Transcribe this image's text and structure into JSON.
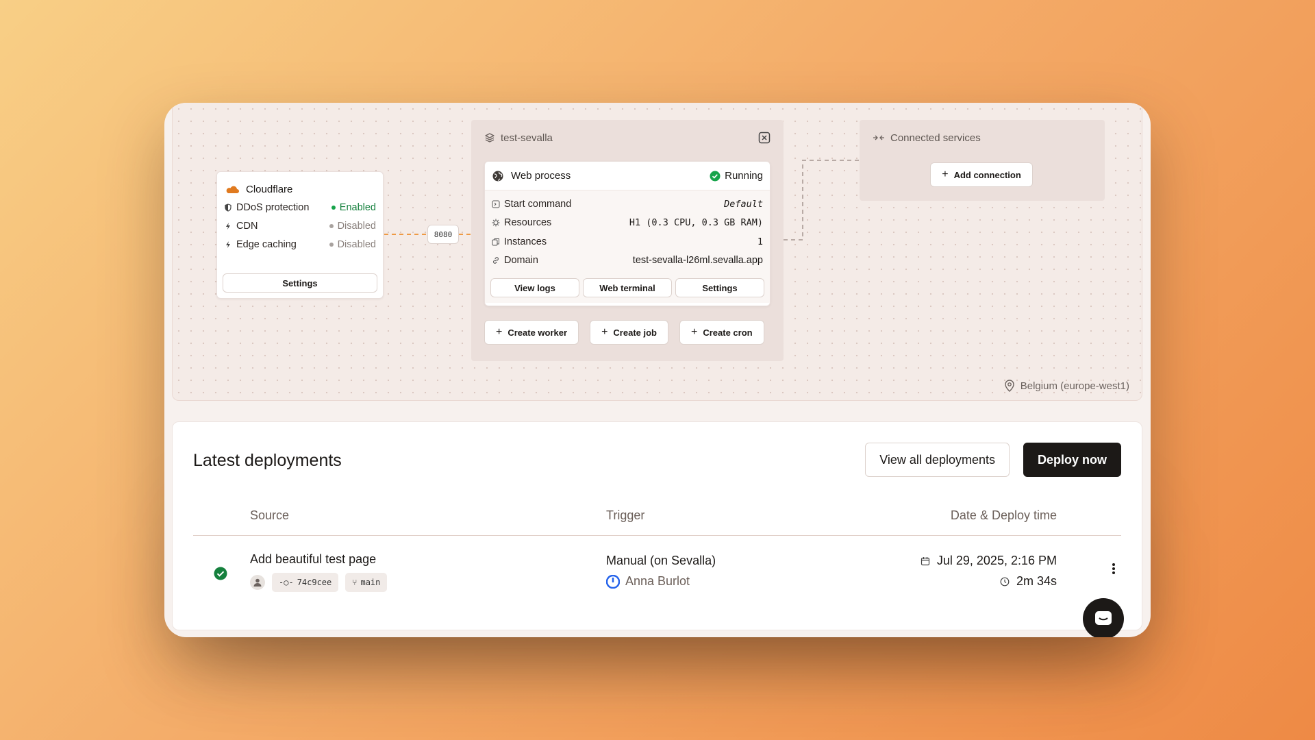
{
  "canvas": {
    "region": "Belgium (europe-west1)",
    "cloudflare": {
      "title": "Cloudflare",
      "rows": [
        {
          "label": "DDoS protection",
          "value": "Enabled",
          "icon": "shield-icon"
        },
        {
          "label": "CDN",
          "value": "Disabled",
          "icon": "bolt-icon"
        },
        {
          "label": "Edge caching",
          "value": "Disabled",
          "icon": "bolt-icon"
        }
      ],
      "settings_label": "Settings"
    },
    "port": "8080",
    "app": {
      "name": "test-sevalla",
      "web": {
        "title": "Web process",
        "status": "Running",
        "rows": [
          {
            "label": "Start command",
            "value": "Default"
          },
          {
            "label": "Resources",
            "value": "H1 (0.3 CPU, 0.3 GB RAM)"
          },
          {
            "label": "Instances",
            "value": "1"
          },
          {
            "label": "Domain",
            "value": "test-sevalla-l26ml.sevalla.app"
          }
        ],
        "buttons": {
          "logs": "View logs",
          "terminal": "Web terminal",
          "settings": "Settings"
        }
      },
      "create": {
        "worker": "Create worker",
        "job": "Create job",
        "cron": "Create cron"
      }
    },
    "connected": {
      "title": "Connected services",
      "add_label": "Add connection"
    }
  },
  "deployments": {
    "title": "Latest deployments",
    "view_all": "View all deployments",
    "deploy_now": "Deploy now",
    "columns": {
      "source": "Source",
      "trigger": "Trigger",
      "date": "Date & Deploy time"
    },
    "rows": [
      {
        "message": "Add beautiful test page",
        "commit": "74c9cee",
        "branch": "main",
        "trigger": "Manual (on Sevalla)",
        "user": "Anna Burlot",
        "date": "Jul 29, 2025, 2:16 PM",
        "duration": "2m 34s"
      }
    ]
  },
  "colors": {
    "accent": "#1c1917",
    "success": "#16a34a",
    "cloudflare": "#e07a1f",
    "user": "#2563eb"
  }
}
